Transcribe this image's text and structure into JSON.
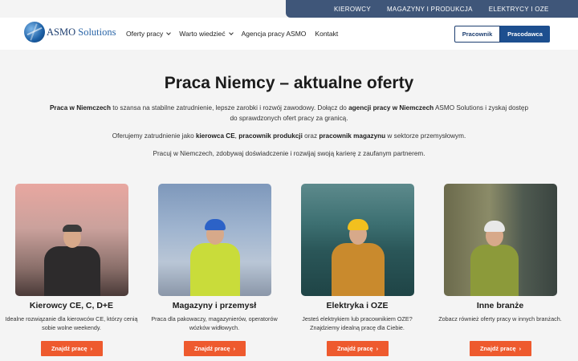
{
  "topbar": {
    "links": [
      "KIEROWCY",
      "MAGAZYNY I PRODUKCJA",
      "ELEKTRYCY I OZE"
    ]
  },
  "logo": {
    "brand": "ASMO",
    "suffix": "Solutions"
  },
  "nav": {
    "items": [
      {
        "label": "Oferty pracy",
        "dropdown": true
      },
      {
        "label": "Warto wiedzieć",
        "dropdown": true
      },
      {
        "label": "Agencja pracy ASMO",
        "dropdown": false
      },
      {
        "label": "Kontakt",
        "dropdown": false
      }
    ]
  },
  "header_buttons": {
    "worker": "Pracownik",
    "employer": "Pracodawca"
  },
  "hero": {
    "title": "Praca Niemcy – aktualne oferty",
    "p1_strong1": "Praca w Niemczech",
    "p1_text1": " to szansa na stabilne zatrudnienie, lepsze zarobki i rozwój zawodowy. Dołącz do ",
    "p1_strong2": "agencji pracy w Niemczech",
    "p1_text2": " ASMO Solutions i zyskaj dostęp do sprawdzonych ofert pracy za granicą.",
    "p2_text1": "Oferujemy zatrudnienie jako ",
    "p2_strong1": "kierowca CE",
    "p2_text2": ", ",
    "p2_strong2": "pracownik produkcji",
    "p2_text3": " oraz ",
    "p2_strong3": "pracownik magazynu",
    "p2_text4": " w sektorze przemysłowym.",
    "p3": "Pracuj w Niemczech, zdobywaj doświadczenie i rozwijaj swoją karierę z zaufanym partnerem."
  },
  "cards": [
    {
      "title": "Kierowcy CE, C, D+E",
      "desc": "Idealne rozwiązanie dla kierowców CE, którzy cenią sobie wolne weekendy.",
      "button": "Znajdź pracę"
    },
    {
      "title": "Magazyny i przemysł",
      "desc": "Praca dla pakowaczy, magazynierów, operatorów wózków widłowych.",
      "button": "Znajdź pracę"
    },
    {
      "title": "Elektryka i OZE",
      "desc": "Jesteś elektrykiem lub pracownikiem OZE? Znajdziemy idealną pracę dla Ciebie.",
      "button": "Znajdź pracę"
    },
    {
      "title": "Inne branże",
      "desc": "Zobacz również oferty pracy w innych branżach.",
      "button": "Znajdź pracę"
    }
  ],
  "colors": {
    "topbar": "#3f5679",
    "brand": "#1d4f8f",
    "accent": "#ee5a2e"
  }
}
